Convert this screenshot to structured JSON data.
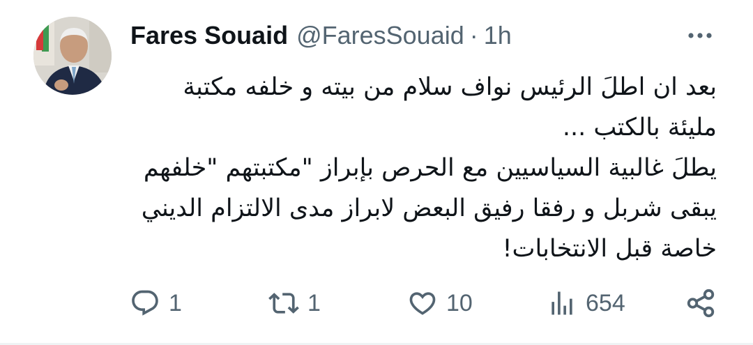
{
  "tweet": {
    "author": {
      "name": "Fares Souaid",
      "handle": "@FaresSouaid",
      "separator": "·",
      "time": "1h"
    },
    "lines": [
      "بعد ان اطلَ الرئيس نواف سلام من بيته و خلفه مكتبة",
      "مليئة بالكتب ...",
      "يطلَ غالبية السياسيين مع الحرص بإبراز \"مكتبتهم \"خلفهم",
      "يبقى شربل و رفقا رفيق البعض لابراز مدى الالتزام الديني",
      "خاصة قبل الانتخابات!"
    ]
  },
  "actions": {
    "replies": "1",
    "reposts": "1",
    "likes": "10",
    "views": "654"
  },
  "icons": {
    "more": "more-horizontal-icon",
    "reply": "reply-icon",
    "repost": "repost-icon",
    "like": "heart-icon",
    "views": "views-chart-icon",
    "share": "share-icon"
  },
  "colors": {
    "text": "#0f1419",
    "secondary": "#536471",
    "divider": "#eff3f4"
  }
}
